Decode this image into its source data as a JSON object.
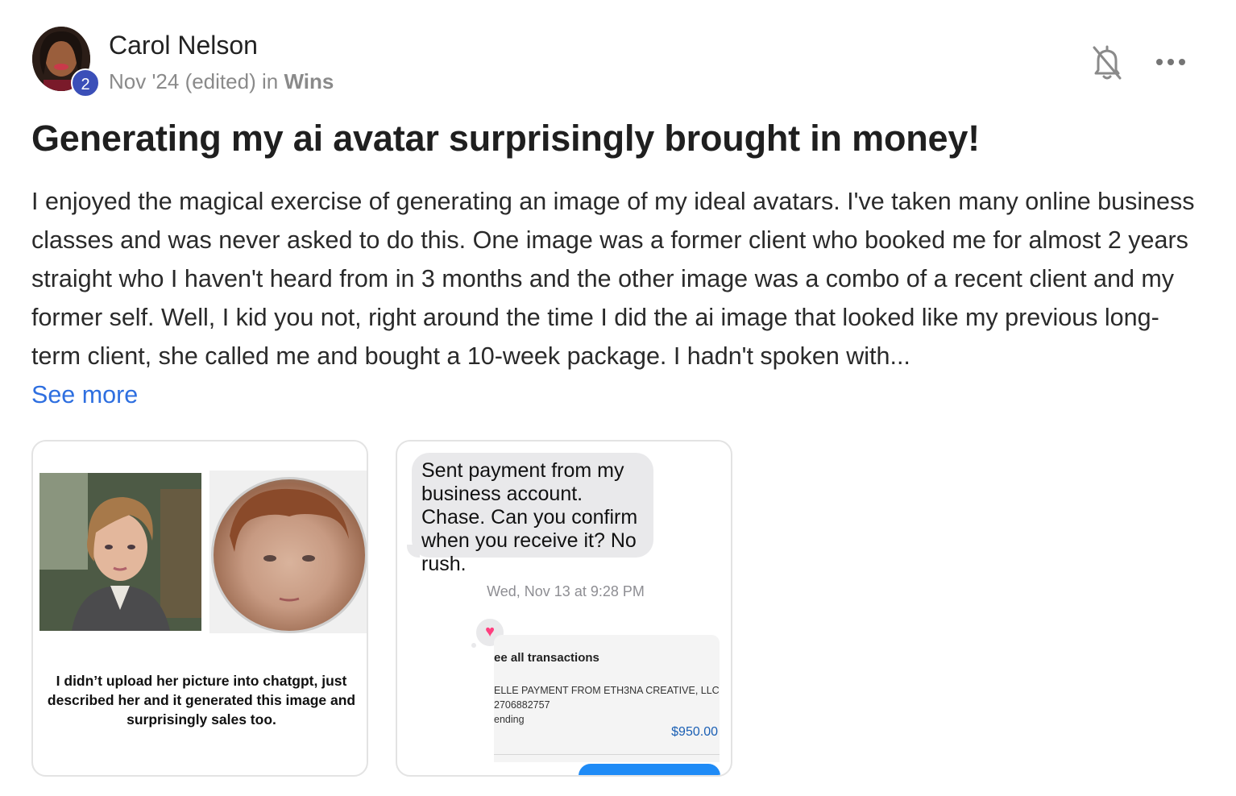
{
  "post": {
    "author": "Carol Nelson",
    "level": "2",
    "date": "Nov '24 (edited)",
    "in_word": "in",
    "category": "Wins",
    "title": "Generating my ai avatar surprisingly brought in money!",
    "body": "I enjoyed the magical exercise of generating an image of my ideal avatars. I've taken many online business classes and was never asked to do this. One image was a former client who booked me for almost 2 years straight who I haven't heard from in 3 months and the other image was a combo of a recent client and my former self. Well, I kid you not, right around the time I did the ai image that looked like my previous long-term client, she called me and bought a 10-week package. I hadn't spoken with...",
    "see_more": "See more"
  },
  "icons": {
    "bell": "bell-off-icon",
    "more": "more-horizontal-icon"
  },
  "attachments": {
    "image1": {
      "caption": "I didn’t upload her picture into chatgpt, just described her and it generated this image and surprisingly sales too."
    },
    "image2": {
      "message": "Sent payment from my business account. Chase. Can you confirm when you receive it? No rush.",
      "timestamp_day": "Wed, Nov 13",
      "timestamp_at": "at",
      "timestamp_time": "9:28 PM",
      "txn_header": "ee all transactions",
      "txn_desc": "ELLE PAYMENT FROM ETH3NA CREATIVE, LLC",
      "txn_ref": "2706882757",
      "txn_status": "ending",
      "txn_amount": "$950.00"
    }
  },
  "colors": {
    "link": "#2e6fe0",
    "badge": "#3b4fb8",
    "imessage_blue": "#1f8bf6",
    "heart": "#ff3f7f"
  }
}
